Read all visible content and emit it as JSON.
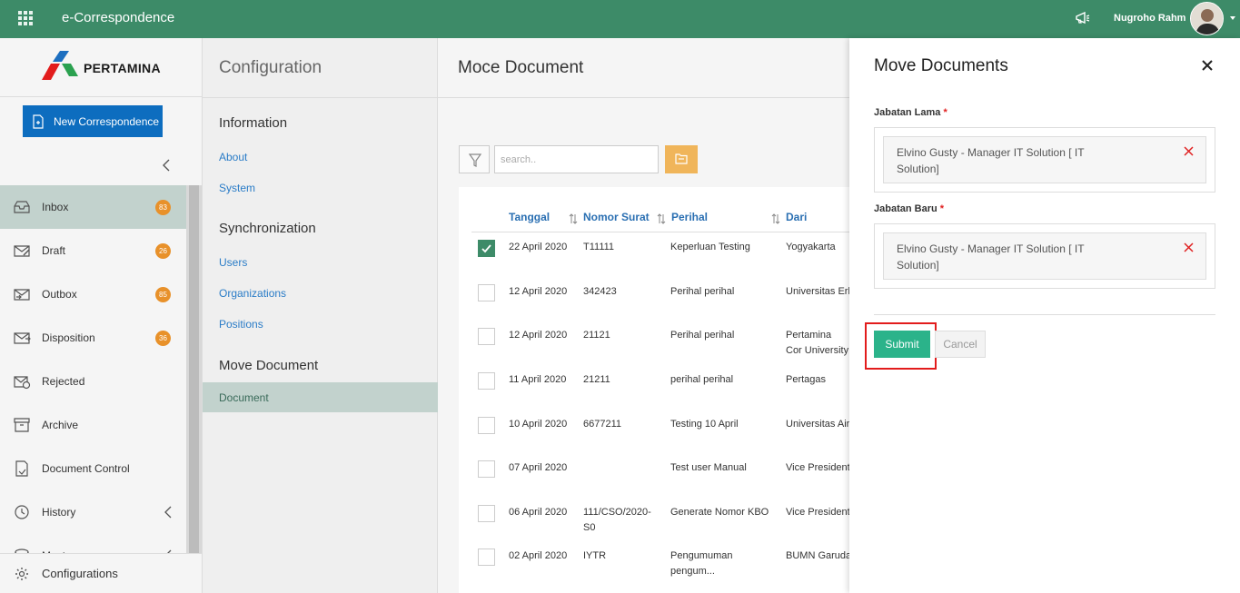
{
  "app": {
    "title": "e-Correspondence",
    "user_name": "Nugroho Rahm"
  },
  "logo": {
    "text": "PERTAMINA"
  },
  "sidebar": {
    "new_button": "New Correspondence",
    "items": [
      {
        "label": "Inbox",
        "badge": "83",
        "icon": "inbox-icon"
      },
      {
        "label": "Draft",
        "badge": "26",
        "icon": "draft-icon"
      },
      {
        "label": "Outbox",
        "badge": "85",
        "icon": "outbox-icon"
      },
      {
        "label": "Disposition",
        "badge": "36",
        "icon": "disposition-icon"
      },
      {
        "label": "Rejected",
        "icon": "rejected-icon"
      },
      {
        "label": "Archive",
        "icon": "archive-icon"
      },
      {
        "label": "Document Control",
        "icon": "document-control-icon"
      },
      {
        "label": "History",
        "icon": "history-icon"
      },
      {
        "label": "Master",
        "icon": "master-icon"
      }
    ],
    "configurations": "Configurations"
  },
  "config": {
    "title": "Configuration",
    "sections": [
      {
        "heading": "Information",
        "links": [
          "About",
          "System"
        ]
      },
      {
        "heading": "Synchronization",
        "links": [
          "Users",
          "Organizations",
          "Positions"
        ]
      },
      {
        "heading": "Move Document",
        "links": [
          "Document"
        ]
      }
    ]
  },
  "main": {
    "title": "Moce Document",
    "search_placeholder": "search..",
    "columns": [
      "Tanggal",
      "Nomor Surat",
      "Perihal",
      "Dari"
    ],
    "rows": [
      {
        "checked": true,
        "tanggal": "22 April 2020",
        "nomor": "T11111",
        "perihal": "Keperluan Testing",
        "dari": "Yogyakarta"
      },
      {
        "checked": false,
        "tanggal": "12 April 2020",
        "nomor": "342423",
        "perihal": "Perihal perihal",
        "dari": "Universitas Erl"
      },
      {
        "checked": false,
        "tanggal": "12 April 2020",
        "nomor": "21121",
        "perihal": "Perihal perihal",
        "dari": "Pertamina Cor University"
      },
      {
        "checked": false,
        "tanggal": "11 April 2020",
        "nomor": "21211",
        "perihal": "perihal perihal",
        "dari": "Pertagas"
      },
      {
        "checked": false,
        "tanggal": "10 April 2020",
        "nomor": "6677211",
        "perihal": "Testing 10 April",
        "dari": "Universitas Air"
      },
      {
        "checked": false,
        "tanggal": "07 April 2020",
        "nomor": "",
        "perihal": "Test user Manual",
        "dari": "Vice President"
      },
      {
        "checked": false,
        "tanggal": "06 April 2020",
        "nomor": "111/CSO/2020-S0",
        "perihal": "Generate Nomor KBO",
        "dari": "Vice President"
      },
      {
        "checked": false,
        "tanggal": "02 April 2020",
        "nomor": "IYTR",
        "perihal": "Pengumuman pengum...",
        "dari": "BUMN Garuda"
      }
    ]
  },
  "modal": {
    "title": "Move Documents",
    "old_label": "Jabatan Lama",
    "old_value": "Elvino Gusty - Manager IT Solution [ IT Solution]",
    "new_label": "Jabatan Baru",
    "new_value": "Elvino Gusty - Manager IT Solution [ IT Solution]",
    "required_mark": "*",
    "submit": "Submit",
    "cancel": "Cancel"
  },
  "colors": {
    "topbar": "#3d8b68",
    "primary_button": "#0d6dbf",
    "badge": "#e8912a",
    "submit": "#2bb38a",
    "highlight": "#e21c1c"
  }
}
